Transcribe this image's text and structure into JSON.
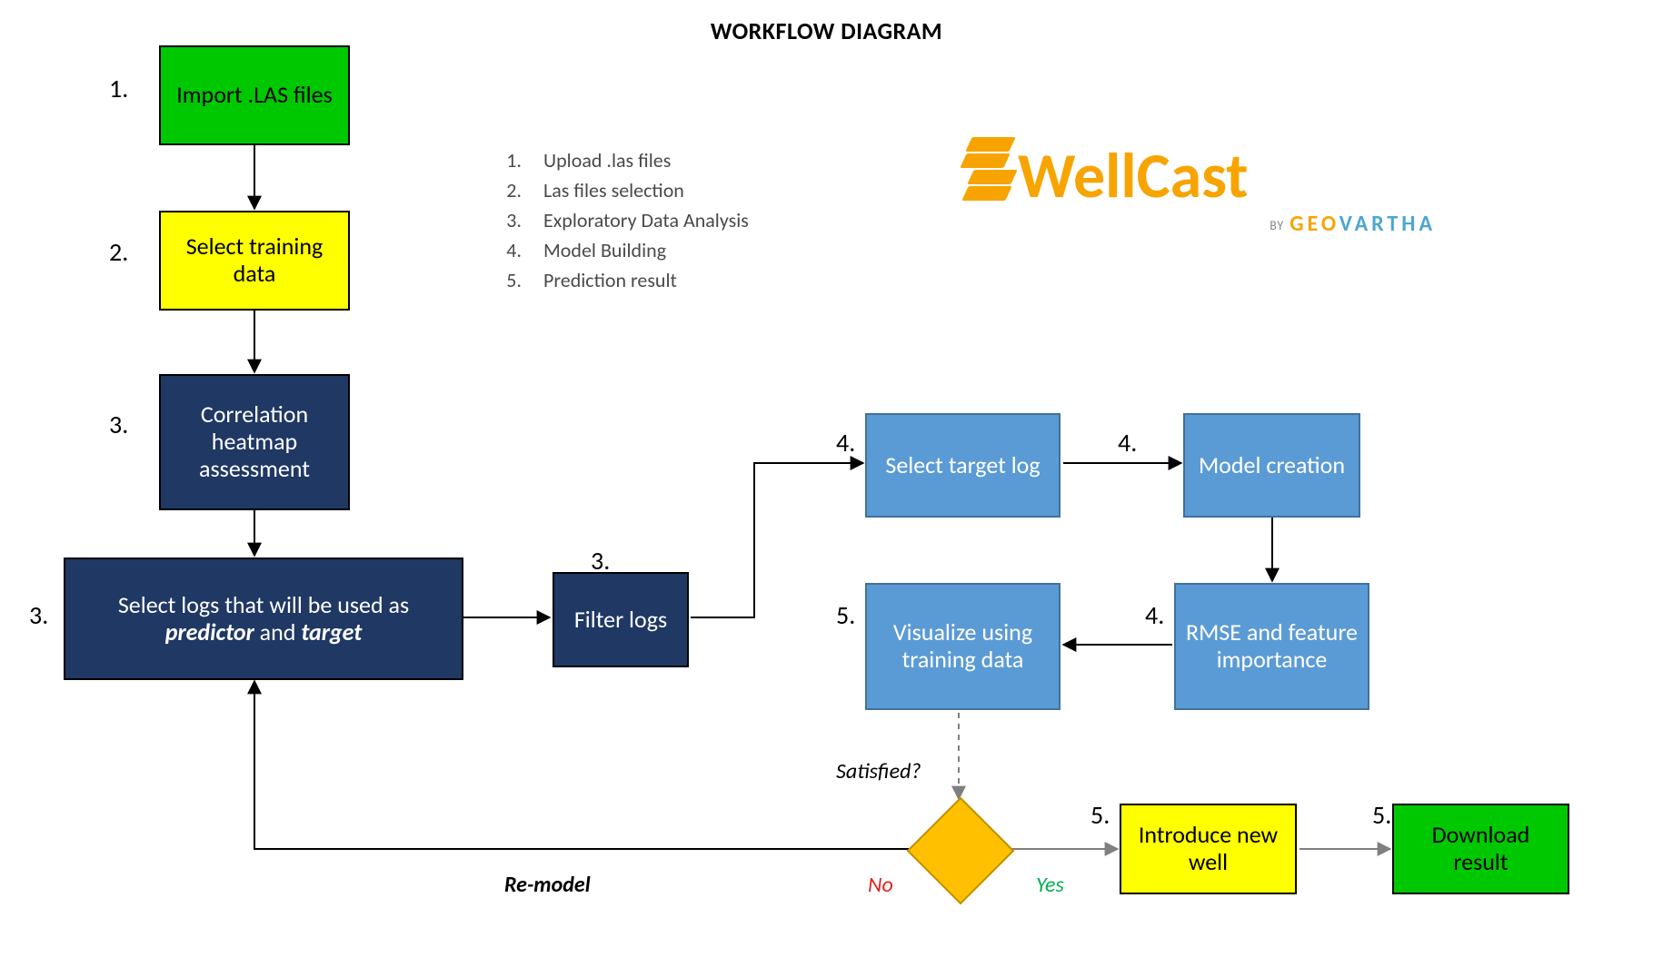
{
  "title": "WORKFLOW DIAGRAM",
  "legend": [
    {
      "n": "1.",
      "t": "Upload .las files"
    },
    {
      "n": "2.",
      "t": "Las files selection"
    },
    {
      "n": "3.",
      "t": "Exploratory Data Analysis"
    },
    {
      "n": "4.",
      "t": "Model Building"
    },
    {
      "n": "5.",
      "t": "Prediction result"
    }
  ],
  "logo": {
    "name": "WellCast",
    "byline_prefix": "BY",
    "byline_brand1": "GEO",
    "byline_brand2": "VARTHA"
  },
  "steps": {
    "n1": "1.",
    "n2": "2.",
    "n3a": "3.",
    "n3b": "3.",
    "n3c": "3.",
    "n4a": "4.",
    "n4b": "4.",
    "n4c": "4.",
    "n5a": "5.",
    "n5b": "5.",
    "n5c": "5."
  },
  "boxes": {
    "import": "Import .LAS files",
    "select_train": "Select training data",
    "corr": "Correlation heatmap assessment",
    "select_logs_pre": "Select logs that will be used as ",
    "select_logs_predictor": "predictor",
    "select_logs_and": " and ",
    "select_logs_target": "target",
    "filter": "Filter logs",
    "select_target": "Select target log",
    "model": "Model creation",
    "rmse": "RMSE and feature importance",
    "viz": "Visualize using training data",
    "new_well": "Introduce new well",
    "download": "Download result"
  },
  "labels": {
    "satisfied": "Satisfied?",
    "no": "No",
    "yes": "Yes",
    "remodel": "Re-model"
  }
}
